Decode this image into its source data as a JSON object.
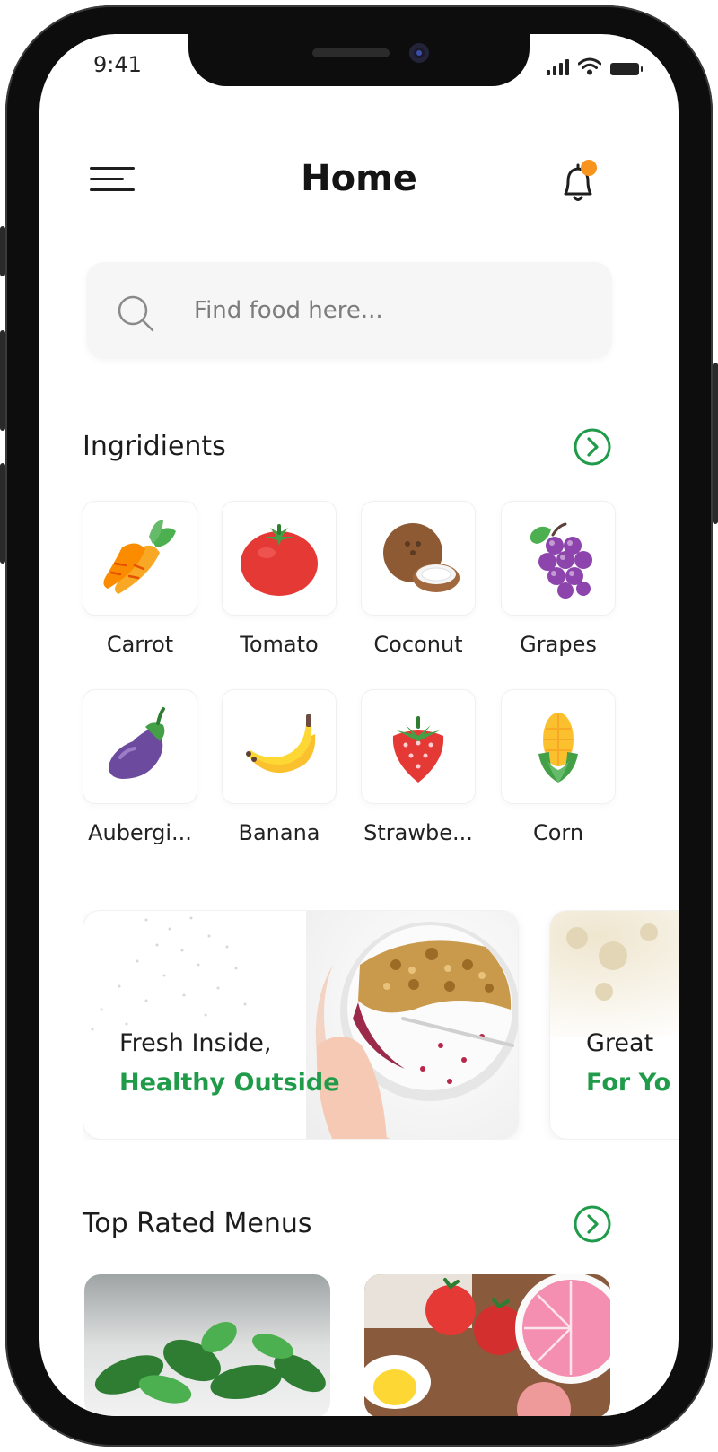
{
  "status_bar": {
    "time": "9:41"
  },
  "header": {
    "title": "Home"
  },
  "search": {
    "placeholder": "Find food here..."
  },
  "ingredients": {
    "title": "Ingridients",
    "items": [
      {
        "label": "Carrot",
        "icon": "carrot-icon"
      },
      {
        "label": "Tomato",
        "icon": "tomato-icon"
      },
      {
        "label": "Coconut",
        "icon": "coconut-icon"
      },
      {
        "label": "Grapes",
        "icon": "grapes-icon"
      },
      {
        "label": "Aubergi...",
        "icon": "aubergine-icon"
      },
      {
        "label": "Banana",
        "icon": "banana-icon"
      },
      {
        "label": "Strawbe...",
        "icon": "strawberry-icon"
      },
      {
        "label": "Corn",
        "icon": "corn-icon"
      }
    ]
  },
  "banners": [
    {
      "line1": "Fresh Inside,",
      "line2": "Healthy Outside"
    },
    {
      "line1": "Great",
      "line2": "For Yo"
    }
  ],
  "top_rated": {
    "title": "Top Rated Menus"
  },
  "colors": {
    "accent": "#1f9b4a",
    "notification_dot": "#f7941d",
    "frame": "#0d0d0d"
  }
}
